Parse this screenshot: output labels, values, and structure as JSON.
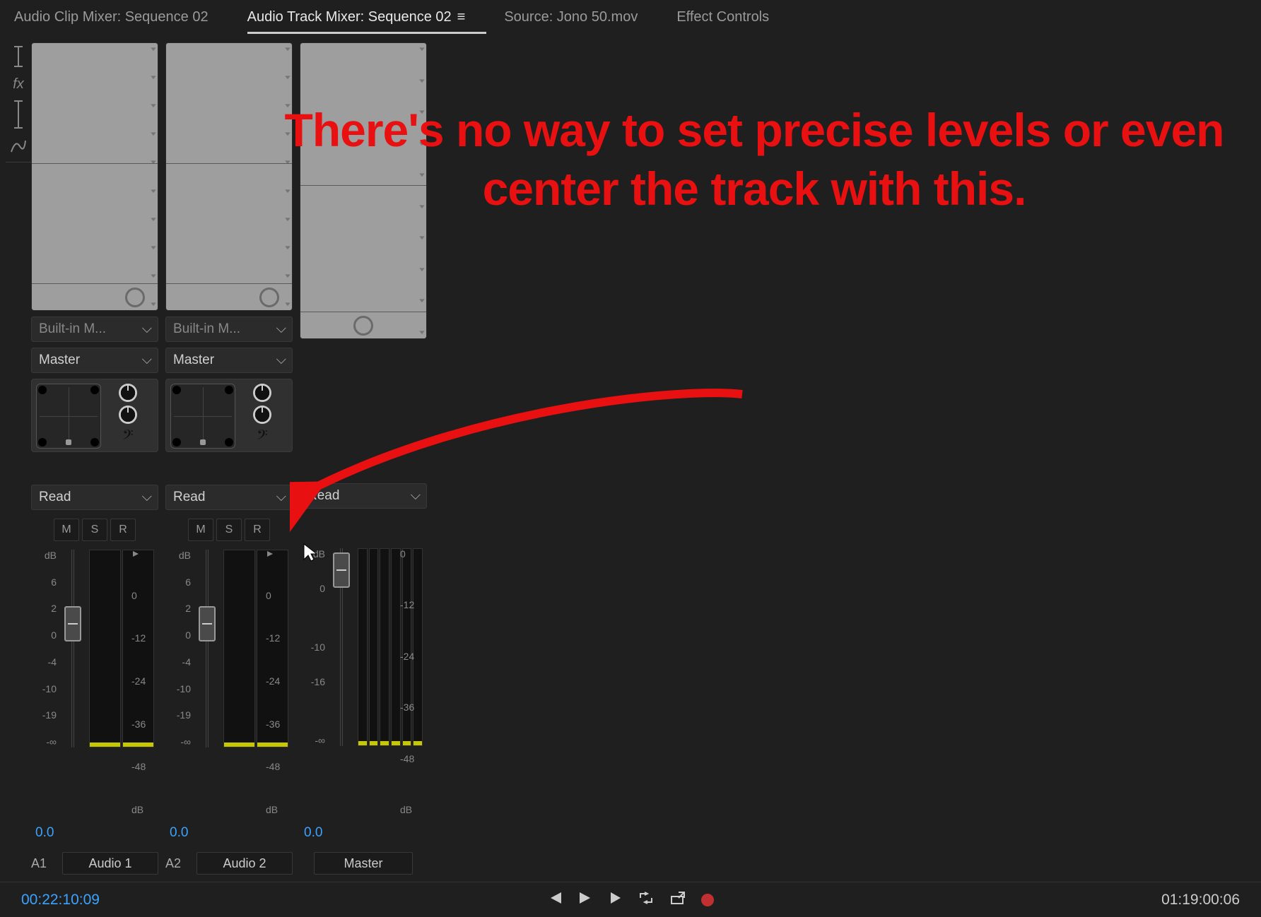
{
  "tabs": {
    "clip_mixer": "Audio Clip Mixer: Sequence 02",
    "track_mixer": "Audio Track Mixer: Sequence 02",
    "source": "Source: Jono 50.mov",
    "effect_controls": "Effect Controls"
  },
  "dropdowns": {
    "builtin": "Built-in M...",
    "master": "Master",
    "read": "Read"
  },
  "buttons": {
    "mute": "M",
    "solo": "S",
    "record": "R"
  },
  "fader_scale": {
    "label": "dB",
    "ticks": [
      "6",
      "2",
      "0",
      "-4",
      "-10",
      "-19",
      "-∞"
    ]
  },
  "fader_scale_master": {
    "label": "dB",
    "ticks": [
      "0",
      "-10",
      "-16",
      "-∞"
    ]
  },
  "meter_scale": {
    "ticks": [
      "0",
      "-12",
      "-24",
      "-36",
      "-48",
      "dB"
    ]
  },
  "tracks": [
    {
      "id": "A1",
      "name": "Audio 1",
      "gain": "0.0"
    },
    {
      "id": "A2",
      "name": "Audio 2",
      "gain": "0.0"
    },
    {
      "id": "",
      "name": "Master",
      "gain": "0.0"
    }
  ],
  "transport": {
    "tc_left": "00:22:10:09",
    "tc_right": "01:19:00:06"
  },
  "annotation": "There's no way to set precise levels or even center the track with this."
}
